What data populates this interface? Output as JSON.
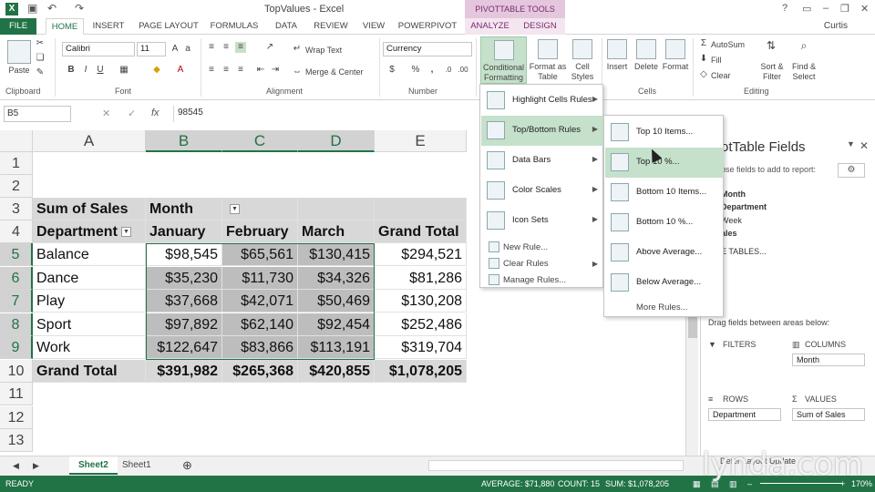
{
  "title": "TopValues - Excel",
  "pivot_tools": "PIVOTTABLE TOOLS",
  "user": "Curtis",
  "tabs": [
    "FILE",
    "HOME",
    "INSERT",
    "PAGE LAYOUT",
    "FORMULAS",
    "DATA",
    "REVIEW",
    "VIEW",
    "POWERPIVOT",
    "ANALYZE",
    "DESIGN"
  ],
  "ribbon": {
    "paste": "Paste",
    "clipboard": "Clipboard",
    "font_name": "Calibri",
    "font_size": "11",
    "font": "Font",
    "wrap_text": "Wrap Text",
    "merge_center": "Merge & Center",
    "alignment": "Alignment",
    "number_format": "Currency",
    "number": "Number",
    "cond_fmt": "Conditional Formatting",
    "format_table": "Format as Table",
    "cell_styles": "Cell Styles",
    "insert": "Insert",
    "delete": "Delete",
    "format": "Format",
    "cells": "Cells",
    "autosum": "AutoSum",
    "fill": "Fill",
    "clear": "Clear",
    "sort_filter": "Sort & Filter",
    "find_select": "Find & Select",
    "editing": "Editing",
    "bold": "B",
    "italic": "I",
    "underline": "U",
    "dollar": "$",
    "percent": "%",
    "comma": ","
  },
  "formula_bar": {
    "name_box": "B5",
    "value": "98545",
    "fx": "fx"
  },
  "columns": [
    "A",
    "B",
    "C",
    "D",
    "E"
  ],
  "rows": [
    "1",
    "2",
    "3",
    "4",
    "5",
    "6",
    "7",
    "8",
    "9",
    "10",
    "11",
    "12",
    "13"
  ],
  "pivot": {
    "sum_of_sales": "Sum of Sales",
    "month": "Month",
    "department": "Department",
    "headers": [
      "January",
      "February",
      "March",
      "Grand Total"
    ],
    "data": [
      {
        "dept": "Balance",
        "vals": [
          "$98,545",
          "$65,561",
          "$130,415",
          "$294,521"
        ]
      },
      {
        "dept": "Dance",
        "vals": [
          "$35,230",
          "$11,730",
          "$34,326",
          "$81,286"
        ]
      },
      {
        "dept": "Play",
        "vals": [
          "$37,668",
          "$42,071",
          "$50,469",
          "$130,208"
        ]
      },
      {
        "dept": "Sport",
        "vals": [
          "$97,892",
          "$62,140",
          "$92,454",
          "$252,486"
        ]
      },
      {
        "dept": "Work",
        "vals": [
          "$122,647",
          "$83,866",
          "$113,191",
          "$319,704"
        ]
      }
    ],
    "grand_total_label": "Grand Total",
    "grand_totals": [
      "$391,982",
      "$265,368",
      "$420,855",
      "$1,078,205"
    ]
  },
  "cf_menu": [
    {
      "label": "Highlight Cells Rules",
      "arrow": "▶"
    },
    {
      "label": "Top/Bottom Rules",
      "arrow": "▶"
    },
    {
      "label": "Data Bars",
      "arrow": "▶"
    },
    {
      "label": "Color Scales",
      "arrow": "▶"
    },
    {
      "label": "Icon Sets",
      "arrow": "▶"
    },
    {
      "label": "New Rule..."
    },
    {
      "label": "Clear Rules",
      "arrow": "▶"
    },
    {
      "label": "Manage Rules..."
    }
  ],
  "tb_menu": [
    "Top 10 Items...",
    "Top 10 %...",
    "Bottom 10 Items...",
    "Bottom 10 %...",
    "Above Average...",
    "Below Average...",
    "More Rules..."
  ],
  "taskpane": {
    "title": "otTable Fields",
    "choose": "ose fields to add to report:",
    "fields": [
      "Month",
      "Department",
      "Week",
      "ales"
    ],
    "more_tables": "E TABLES...",
    "drag": "Drag fields between areas below:",
    "filters": "FILTERS",
    "columns": "COLUMNS",
    "columns_val": "Month",
    "rows": "ROWS",
    "rows_val": "Department",
    "values": "VALUES",
    "values_val": "Sum of Sales",
    "defer": "Defer Layout Update"
  },
  "sheets": [
    "Sheet2",
    "Sheet1"
  ],
  "status": {
    "ready": "READY",
    "average": "AVERAGE: $71,880",
    "count": "COUNT: 15",
    "sum": "SUM: $1,078,205",
    "zoom": "170%"
  },
  "watermark": "lynda.com"
}
